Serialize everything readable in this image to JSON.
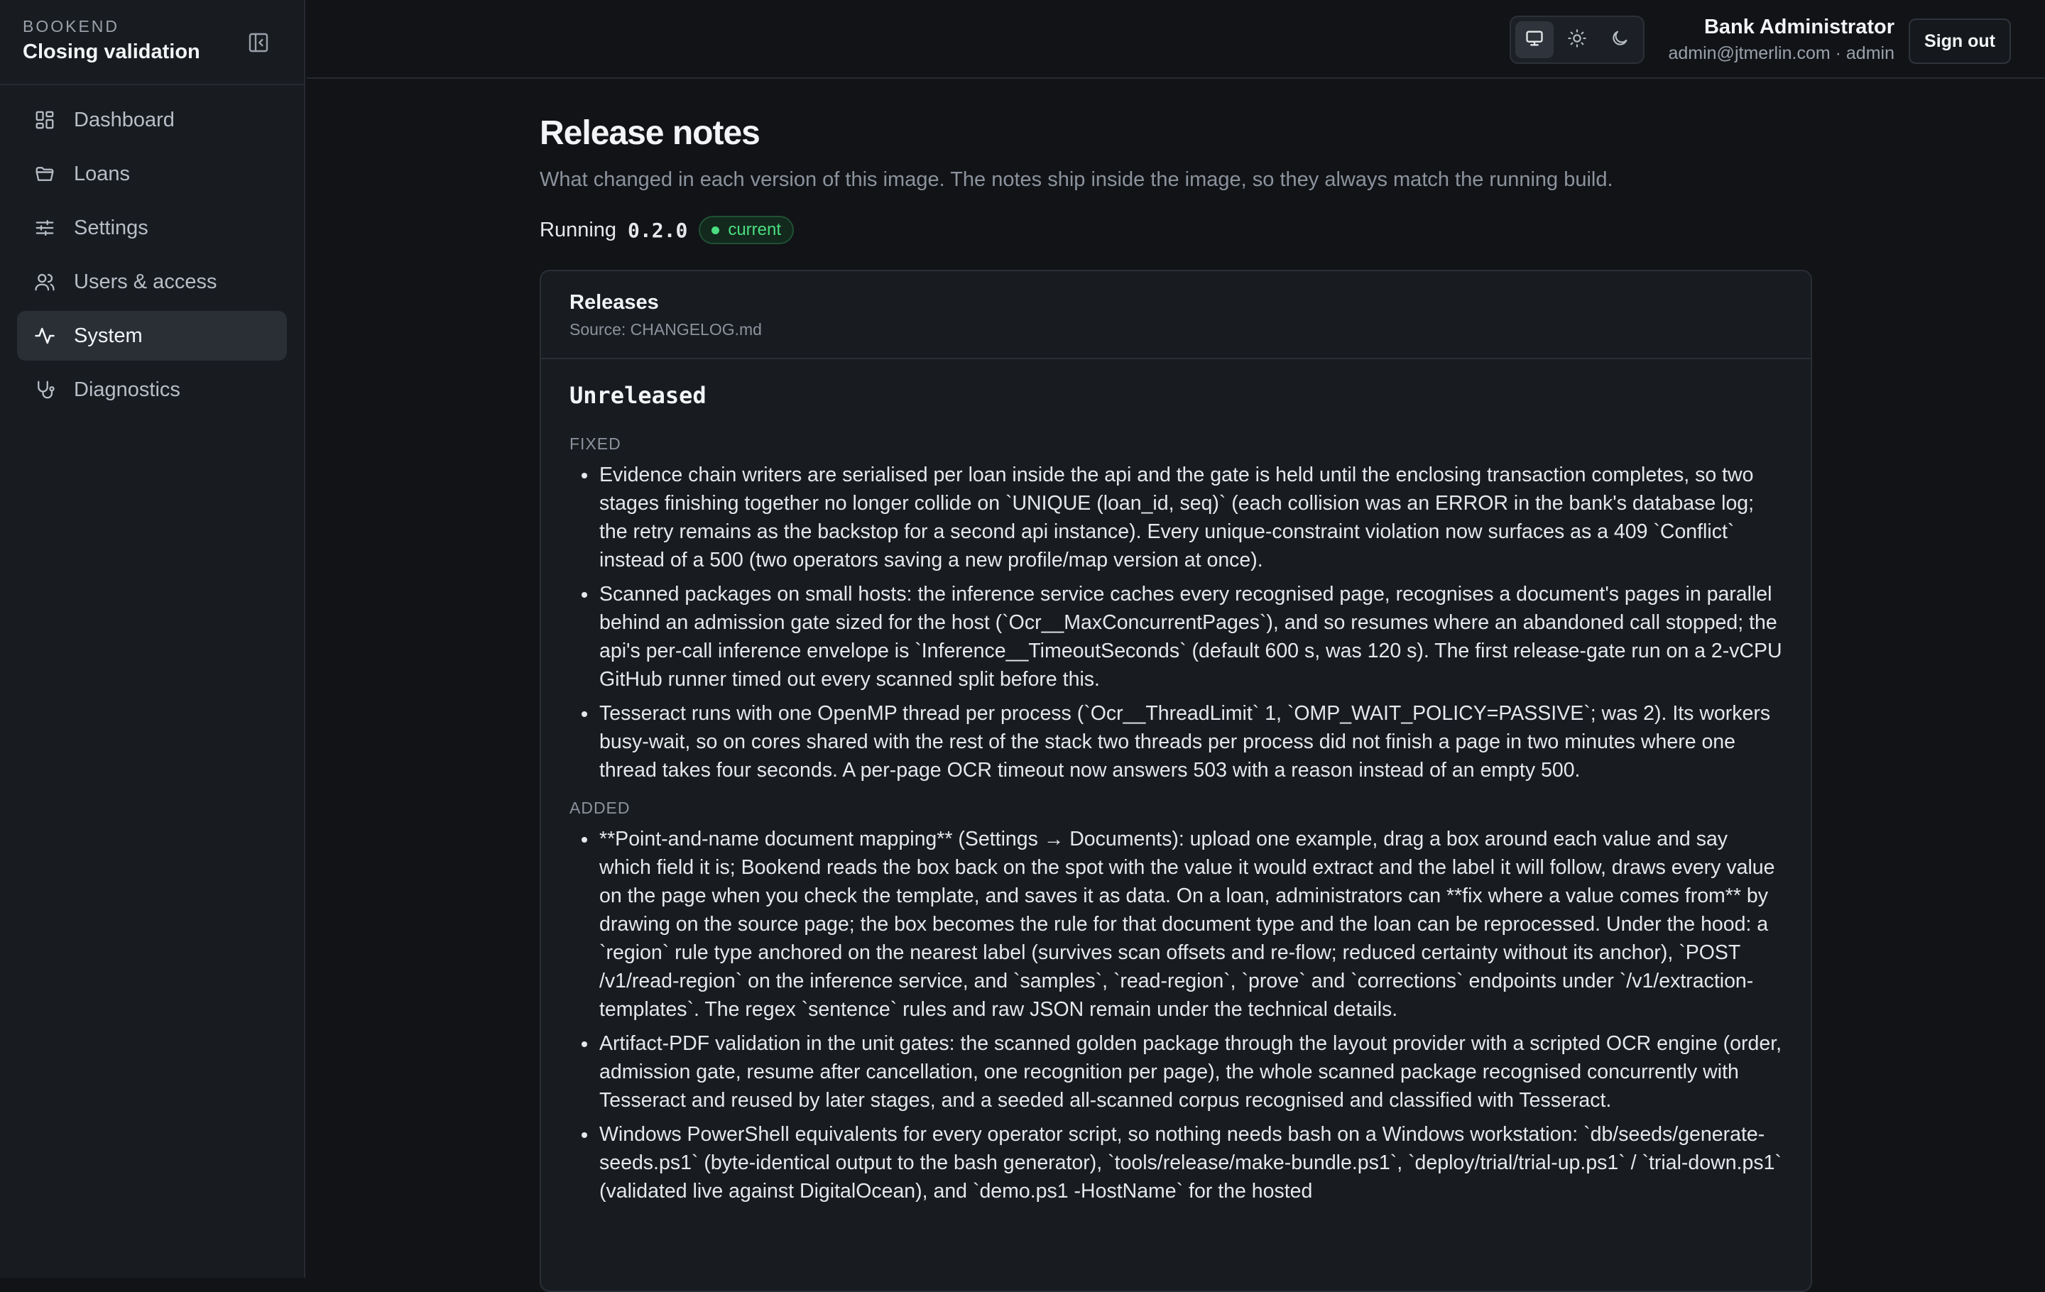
{
  "sidebar": {
    "brand_small": "BOOKEND",
    "brand_title": "Closing validation",
    "items": [
      {
        "label": "Dashboard",
        "icon": "grid-icon"
      },
      {
        "label": "Loans",
        "icon": "folder-icon"
      },
      {
        "label": "Settings",
        "icon": "sliders-icon"
      },
      {
        "label": "Users & access",
        "icon": "users-icon"
      },
      {
        "label": "System",
        "icon": "activity-icon",
        "active": true
      },
      {
        "label": "Diagnostics",
        "icon": "stethoscope-icon"
      }
    ]
  },
  "header": {
    "theme_options": [
      "monitor-icon",
      "sun-icon",
      "moon-icon"
    ],
    "active_theme": "monitor-icon",
    "user_name": "Bank Administrator",
    "user_email": "admin@jtmerlin.com · admin",
    "signout_label": "Sign out"
  },
  "page": {
    "title": "Release notes",
    "subtitle": "What changed in each version of this image. The notes ship inside the image, so they always match the running build.",
    "running_label": "Running",
    "version": "0.2.0",
    "badge": "current",
    "badge_color": "#4ade80"
  },
  "releases": {
    "title": "Releases",
    "source": "Source: CHANGELOG.md",
    "heading": "Unreleased",
    "fixed_label": "FIXED",
    "fixed": [
      "Evidence chain writers are serialised per loan inside the api and the gate is held until the enclosing transaction completes, so two stages finishing together no longer collide on `UNIQUE (loan_id, seq)` (each collision was an ERROR in the bank's database log; the retry remains as the backstop for a second api instance). Every unique-constraint violation now surfaces as a 409 `Conflict` instead of a 500 (two operators saving a new profile/map version at once).",
      "Scanned packages on small hosts: the inference service caches every recognised page, recognises a document's pages in parallel behind an admission gate sized for the host (`Ocr__MaxConcurrentPages`), and so resumes where an abandoned call stopped; the api's per-call inference envelope is `Inference__TimeoutSeconds` (default 600 s, was 120 s). The first release-gate run on a 2-vCPU GitHub runner timed out every scanned split before this.",
      "Tesseract runs with one OpenMP thread per process (`Ocr__ThreadLimit` 1, `OMP_WAIT_POLICY=PASSIVE`; was 2). Its workers busy-wait, so on cores shared with the rest of the stack two threads per process did not finish a page in two minutes where one thread takes four seconds. A per-page OCR timeout now answers 503 with a reason instead of an empty 500."
    ],
    "added_label": "ADDED",
    "added": [
      "**Point-and-name document mapping** (Settings → Documents): upload one example, drag a box around each value and say which field it is; Bookend reads the box back on the spot with the value it would extract and the label it will follow, draws every value on the page when you check the template, and saves it as data. On a loan, administrators can **fix where a value comes from** by drawing on the source page; the box becomes the rule for that document type and the loan can be reprocessed. Under the hood: a `region` rule type anchored on the nearest label (survives scan offsets and re-flow; reduced certainty without its anchor), `POST /v1/read-region` on the inference service, and `samples`, `read-region`, `prove` and `corrections` endpoints under `/v1/extraction-templates`. The regex `sentence` rules and raw JSON remain under the technical details.",
      "Artifact-PDF validation in the unit gates: the scanned golden package through the layout provider with a scripted OCR engine (order, admission gate, resume after cancellation, one recognition per page), the whole scanned package recognised concurrently with Tesseract and reused by later stages, and a seeded all-scanned corpus recognised and classified with Tesseract.",
      "Windows PowerShell equivalents for every operator script, so nothing needs bash on a Windows workstation: `db/seeds/generate-seeds.ps1` (byte-identical output to the bash generator), `tools/release/make-bundle.ps1`, `deploy/trial/trial-up.ps1` / `trial-down.ps1` (validated live against DigitalOcean), and `demo.ps1 -HostName` for the hosted"
    ]
  }
}
